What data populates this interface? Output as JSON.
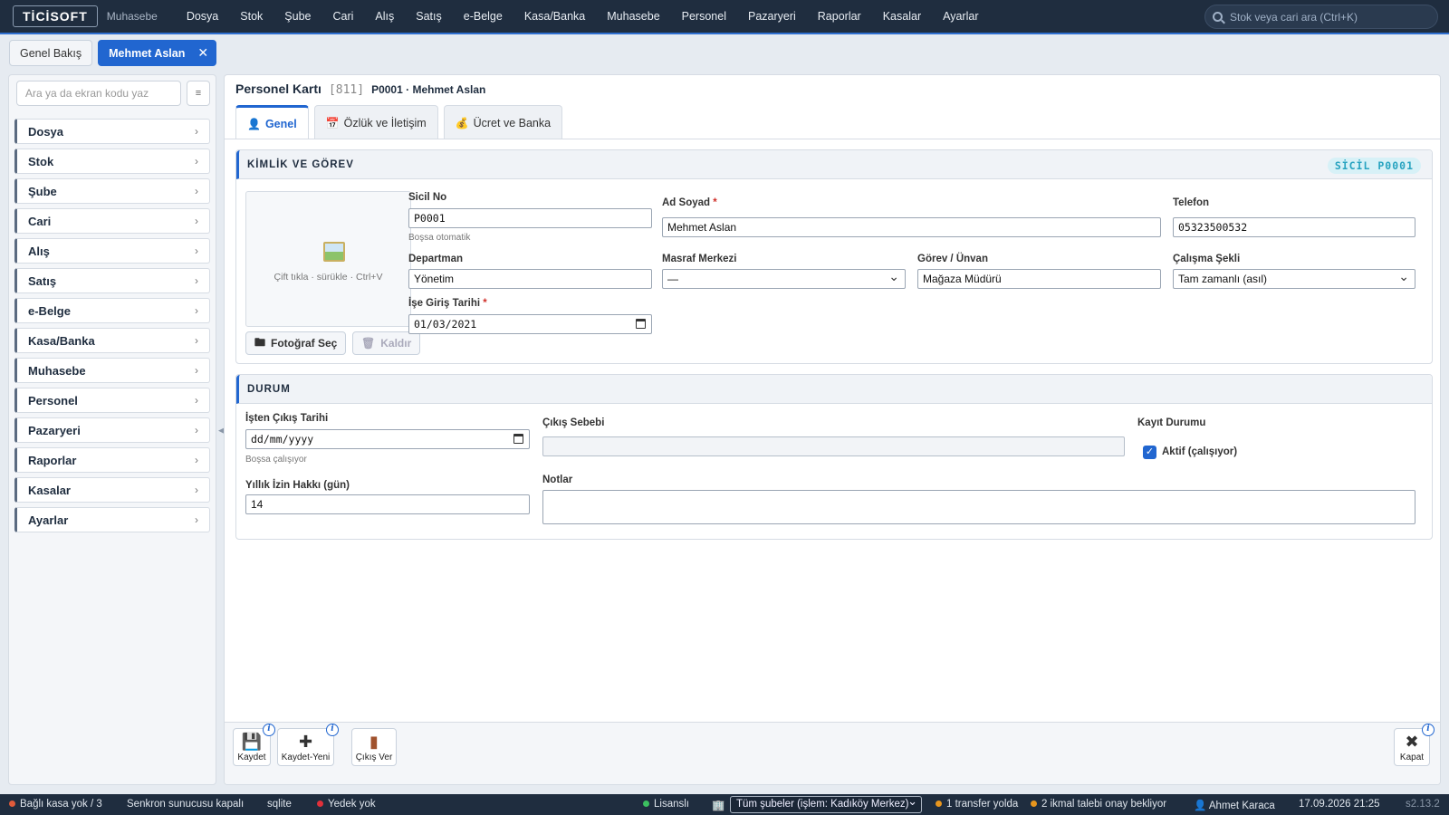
{
  "app": {
    "logo": "TİCİSOFT",
    "module": "Muhasebe"
  },
  "menu": [
    "Dosya",
    "Stok",
    "Şube",
    "Cari",
    "Alış",
    "Satış",
    "e-Belge",
    "Kasa/Banka",
    "Muhasebe",
    "Personel",
    "Pazaryeri",
    "Raporlar",
    "Kasalar",
    "Ayarlar"
  ],
  "top_search": {
    "placeholder": "Stok veya cari ara (Ctrl+K)"
  },
  "doc_tabs": [
    {
      "label": "Genel Bakış",
      "active": false
    },
    {
      "label": "Mehmet Aslan",
      "active": true,
      "close": "✕"
    }
  ],
  "sidebar": {
    "search_placeholder": "Ara ya da ekran kodu yaz",
    "items": [
      "Dosya",
      "Stok",
      "Şube",
      "Cari",
      "Alış",
      "Satış",
      "e-Belge",
      "Kasa/Banka",
      "Muhasebe",
      "Personel",
      "Pazaryeri",
      "Raporlar",
      "Kasalar",
      "Ayarlar"
    ]
  },
  "form": {
    "title": "Personel Kartı",
    "code": "[811]",
    "record": "P0001 · Mehmet Aslan",
    "tabs": [
      {
        "label": "Genel",
        "icon": "👤",
        "active": true
      },
      {
        "label": "Özlük ve İletişim",
        "icon": "📅",
        "active": false
      },
      {
        "label": "Ücret ve Banka",
        "icon": "💰",
        "active": false
      }
    ]
  },
  "identity": {
    "header": "KİMLİK VE GÖREV",
    "badge": "SİCİL P0001",
    "photo_hint": "Çift tıkla · sürükle · Ctrl+V",
    "photo_select": "Fotoğraf Seç",
    "photo_remove": "Kaldır",
    "sicil_label": "Sicil No",
    "sicil_value": "P0001",
    "sicil_hint": "Boşsa otomatik",
    "ad_label": "Ad Soyad",
    "ad_value": "Mehmet Aslan",
    "telefon_label": "Telefon",
    "telefon_value": "05323500532",
    "departman_label": "Departman",
    "departman_value": "Yönetim",
    "masraf_label": "Masraf Merkezi",
    "masraf_value": "—",
    "gorev_label": "Görev / Ünvan",
    "gorev_value": "Mağaza Müdürü",
    "calisma_label": "Çalışma Şekli",
    "calisma_value": "Tam zamanlı (asıl)",
    "giris_label": "İşe Giriş Tarihi",
    "giris_value": "01/03/2021",
    "required_mark": "*"
  },
  "status": {
    "header": "DURUM",
    "cikis_tarih_label": "İşten Çıkış Tarihi",
    "cikis_tarih_value": "dd/mm/yyyy",
    "cikis_tarih_hint": "Boşsa çalışıyor",
    "cikis_sebep_label": "Çıkış Sebebi",
    "cikis_sebep_value": "",
    "kayit_label": "Kayıt Durumu",
    "aktif_label": "Aktif (çalışıyor)",
    "aktif_checked": true,
    "izin_label": "Yıllık İzin Hakkı (gün)",
    "izin_value": "14",
    "notlar_label": "Notlar",
    "notlar_value": ""
  },
  "actions": {
    "save": "Kaydet",
    "save_new": "Kaydet-Yeni",
    "exit": "Çıkış Ver",
    "close": "Kapat",
    "info": "i"
  },
  "statusbar": {
    "kasa": "Bağlı kasa yok / 3",
    "sync": "Senkron sunucusu kapalı",
    "db": "sqlite",
    "backup": "Yedek yok",
    "license": "Lisanslı",
    "branch": "Tüm şubeler (işlem: Kadıköy Merkez)",
    "transfer": "1 transfer yolda",
    "ikmal": "2 ikmal talebi onay bekliyor",
    "user": "Ahmet Karaca",
    "datetime": "17.09.2026 21:25",
    "version": "s2.13.2"
  },
  "colors": {
    "accent": "#2166d0",
    "topbar": "#1f2d3f",
    "badge_text": "#27a3c0",
    "required": "#d0302a"
  }
}
